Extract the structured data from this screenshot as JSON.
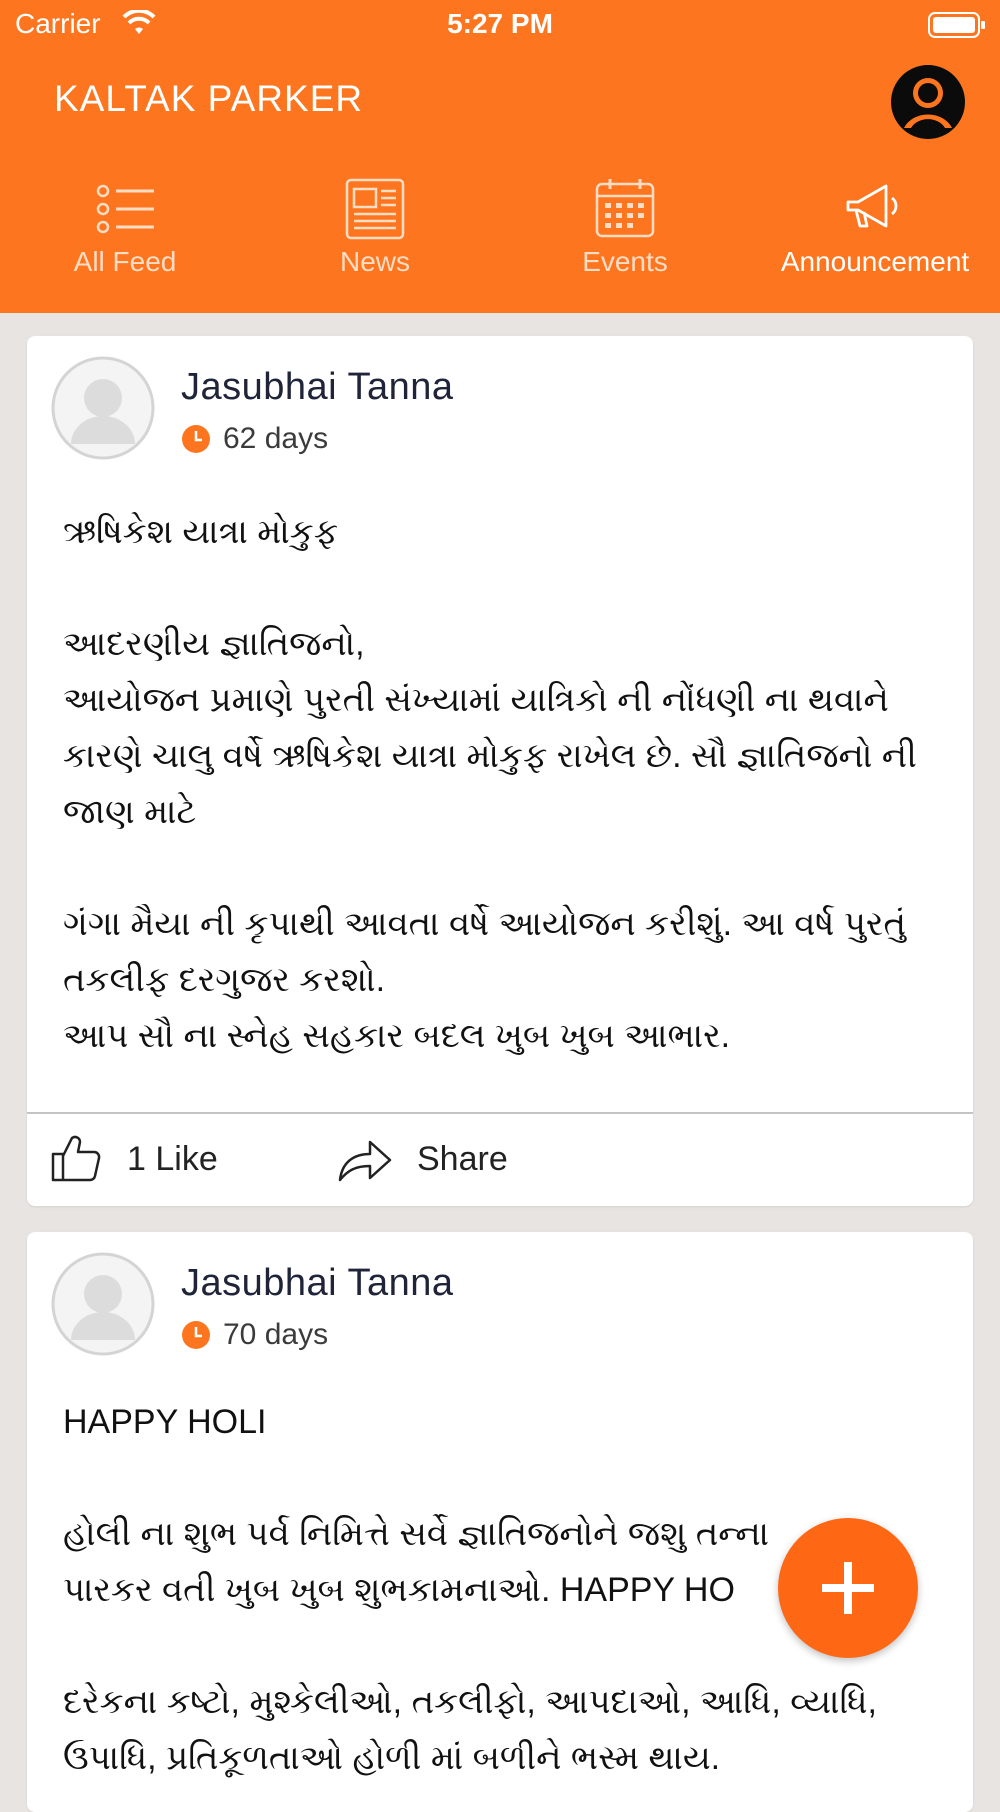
{
  "status_bar": {
    "carrier": "Carrier",
    "time": "5:27 PM"
  },
  "app": {
    "title": "KALTAK PARKER",
    "profile_icon": "user-circle-icon"
  },
  "tabs": [
    {
      "label": "All Feed",
      "icon": "list-icon",
      "active": false
    },
    {
      "label": "News",
      "icon": "newspaper-icon",
      "active": false
    },
    {
      "label": "Events",
      "icon": "calendar-icon",
      "active": false
    },
    {
      "label": "Announcement",
      "icon": "megaphone-icon",
      "active": true
    }
  ],
  "posts": [
    {
      "author": "Jasubhai Tanna",
      "age": "62 days",
      "body": "ઋષિકેશ યાત્રા મોકુફ\n\nઆદરણીય જ્ઞાતિજનો,\nઆયોજન પ્રમાણે પુરતી સંખ્યામાં યાત્રિકો ની નોંધણી ના થવાને કારણે ચાલુ વર્ષે ઋષિકેશ યાત્રા મોકુફ રાખેલ છે. સૌ જ્ઞાતિજનો ની જાણ માટે\n\nગંગા મૈયા ની કૃપાથી આવતા વર્ષે આયોજન કરીશું. આ વર્ષ પુરતું તકલીફ દરગુજર કરશો.\nઆપ સૌ ના સ્નેહ સહકાર બદલ ખુબ ખુબ આભાર.",
      "likes": "1 Like",
      "share": "Share"
    },
    {
      "author": "Jasubhai Tanna",
      "age": "70 days",
      "body": "HAPPY HOLI\n\nહોલી ના શુભ પર્વ નિમિત્તે સર્વે જ્ઞાતિજનોને જશુ તન્ના\nપારકર વતી ખુબ ખુબ શુભકામનાઓ. HAPPY HO\n\nદરેકના કષ્ટો, મુશ્કેલીઓ, તકલીફો, આપદાઓ, આધિ, વ્યાધિ, ઉપાધિ, પ્રતિકૂળતાઓ હોળી માં બળીને ભસ્મ થાય."
    }
  ],
  "fab": {
    "icon": "plus-icon"
  },
  "colors": {
    "brand": "#fd761f",
    "fab": "#fe6713",
    "author": "#1f2438"
  }
}
